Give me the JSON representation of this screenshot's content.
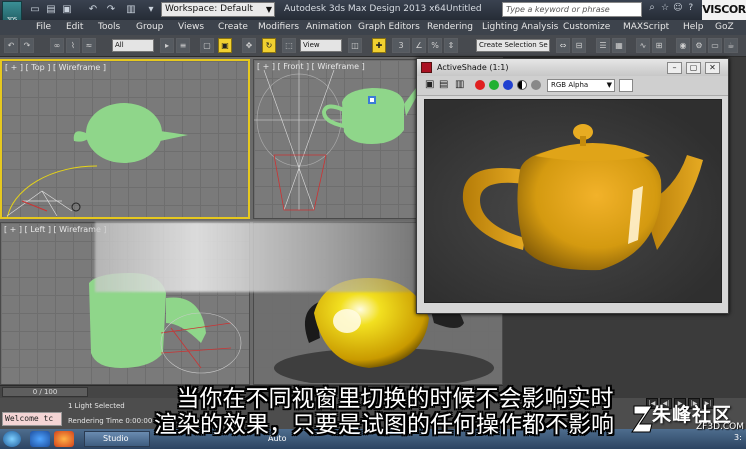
{
  "titlebar": {
    "logo_text": "3DS",
    "workspace": "Workspace: Default",
    "app_title": "Autodesk 3ds Max Design 2013 x64",
    "doc_title": "Untitled",
    "search_placeholder": "Type a keyword or phrase",
    "brand_watermark": "VISCOR"
  },
  "menu": [
    "File",
    "Edit",
    "Tools",
    "Group",
    "Views",
    "Create",
    "Modifiers",
    "Animation",
    "Graph Editors",
    "Rendering",
    "Lighting Analysis",
    "Customize",
    "MAXScript",
    "Help",
    "GoZ"
  ],
  "toolbar": {
    "selection_filter": "All",
    "reference_coord": "View",
    "selection_set": "Create Selection Se",
    "snap_number": "3"
  },
  "viewports": {
    "top_label": "[ + ] [ Top ] [ Wireframe ]",
    "front_label": "[ + ] [ Front ] [ Wireframe ]",
    "left_label": "[ + ] [ Left ] [ Wireframe ]"
  },
  "activeshade": {
    "title": "ActiveShade (1:1)",
    "channel": "RGB Alpha"
  },
  "timeline": {
    "frame_readout": "0 / 100"
  },
  "status": {
    "listener_text": "Welcome tc",
    "selection_status": "1 Light Selected",
    "render_time": "Rendering Time  0:00:00"
  },
  "taskbar": {
    "studio_label": "Studio",
    "auto_label": "Auto",
    "clock": "3:"
  },
  "subtitle": {
    "line1": "当你在不同视窗里切换的时候不会影响实时",
    "line2": "渲染的效果，只要是试图的任何操作都不影响"
  },
  "site_logo": {
    "main": "朱峰社区",
    "sub": "ZF3D.COM"
  },
  "colors": {
    "teapot_wire": "#8fd68a",
    "teapot_gold": "#d49a10",
    "active_tool": "#f1d030"
  }
}
